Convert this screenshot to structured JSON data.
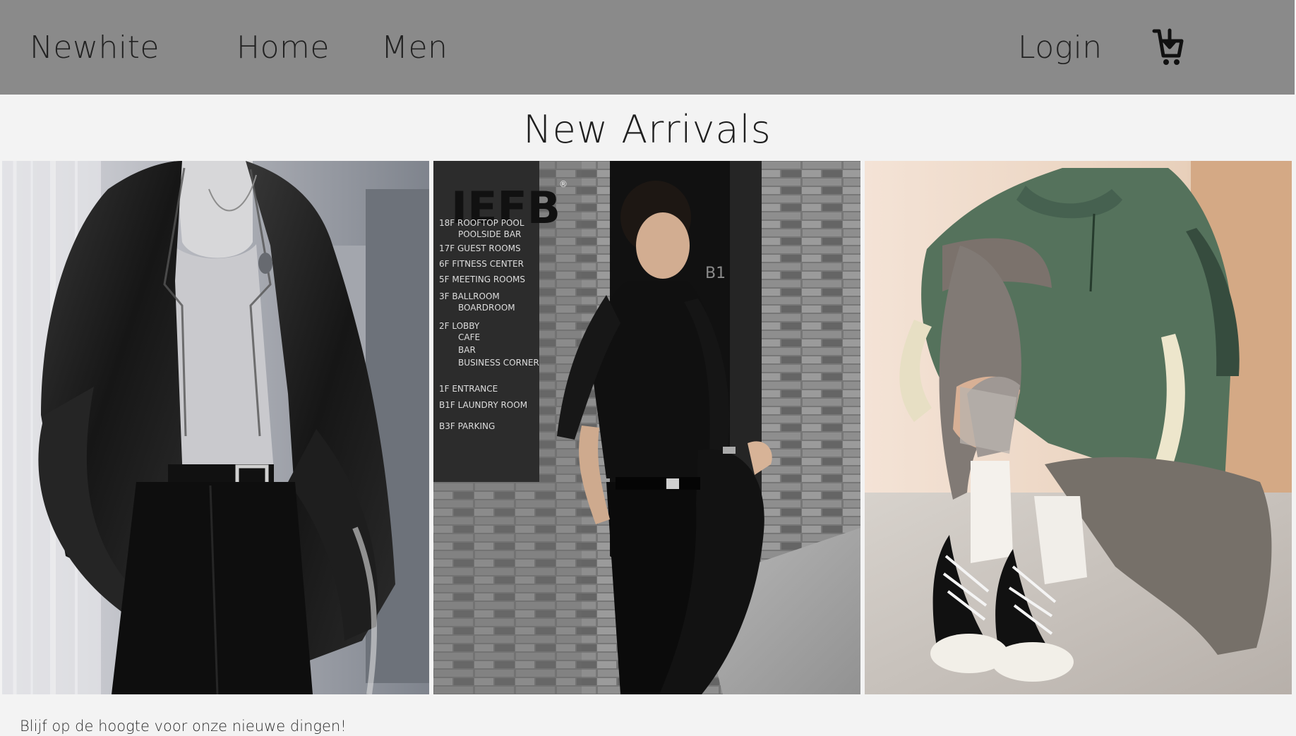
{
  "navbar": {
    "brand": "Newhite",
    "links": [
      "Home",
      "Men"
    ],
    "login": "Login",
    "cart_icon": "shopping-cart-icon",
    "bg_color": "#8a8a8a"
  },
  "main": {
    "title": "New Arrivals",
    "products": [
      {
        "alt": "Man in dark blazer with gray turtleneck"
      },
      {
        "alt": "Man in black sweater standing in hallway",
        "logo_text": "IEFB",
        "sign": [
          "18F ROOFTOP POOL",
          "POOLSIDE BAR",
          "17F GUEST ROOMS",
          "6F FITNESS CENTER",
          "5F MEETING ROOMS",
          "3F BALLROOM",
          "BOARDROOM",
          "2F LOBBY",
          "CAFE",
          "BAR",
          "BUSINESS CORNER",
          "1F ENTRANCE",
          "B1F LAUNDRY ROOM",
          "B3F PARKING"
        ],
        "wall_label": "B1"
      },
      {
        "alt": "Person seated in green half-zip sweatshirt and sneakers"
      }
    ]
  },
  "footer": {
    "text": "Blijf op de hoogte voor onze nieuwe dingen!"
  }
}
